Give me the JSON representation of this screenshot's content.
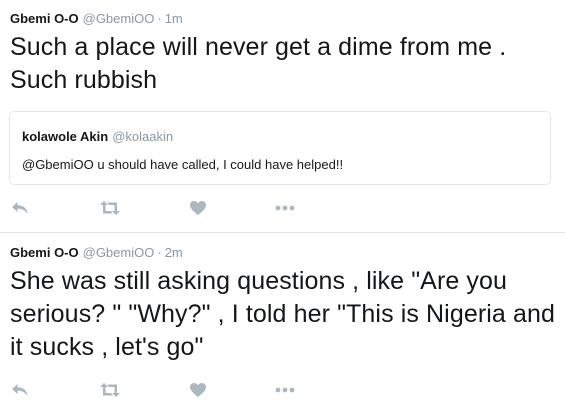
{
  "tweets": [
    {
      "name": "Gbemi O-O",
      "handle": "@GbemiOO",
      "separator": "·",
      "time": "1m",
      "text": "Such a place will never get a dime from me . Such rubbish",
      "quoted": {
        "name": "kolawole Akin",
        "handle": "@kolaakin",
        "text": "@GbemiOO u should have called, I could have helped!!"
      }
    },
    {
      "name": "Gbemi O-O",
      "handle": "@GbemiOO",
      "separator": "·",
      "time": "2m",
      "text": "She was still asking questions , like \"Are you serious? \" \"Why?\" , I told her \"This is Nigeria and it sucks , let's go\""
    }
  ],
  "actions": [
    "reply-icon",
    "retweet-icon",
    "like-icon",
    "more-icon"
  ],
  "colors": {
    "text": "#14171a",
    "muted": "#8899a6",
    "icon": "#aab8c2",
    "border": "#e1e8ed"
  }
}
